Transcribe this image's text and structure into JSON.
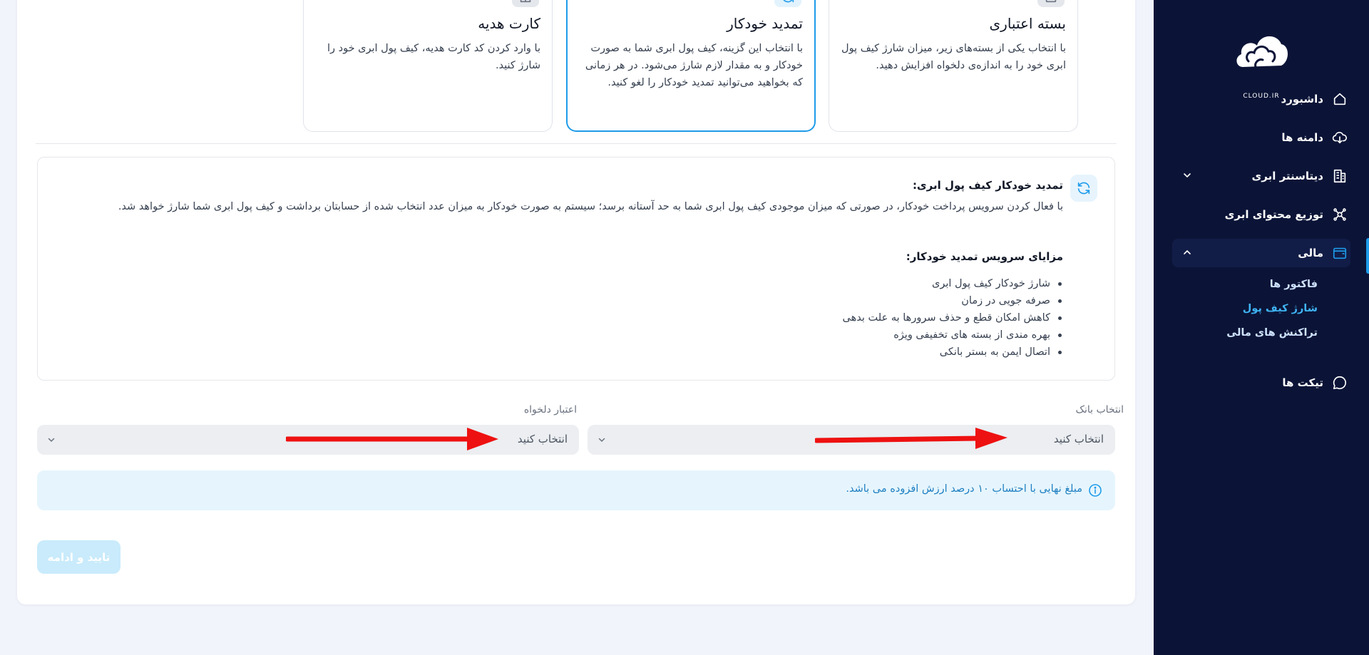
{
  "sidebar": {
    "logo_text": "CLOUD.IR",
    "items": [
      {
        "label": "داشبورد",
        "icon": "home-icon"
      },
      {
        "label": "دامنه ها",
        "icon": "cloud-download-icon"
      },
      {
        "label": "دیتاسنتر ابری",
        "icon": "building-icon"
      },
      {
        "label": "توزیع محتوای ابری",
        "icon": "network-icon"
      },
      {
        "label": "مالی",
        "icon": "wallet-icon"
      },
      {
        "label": "تیکت ها",
        "icon": "chat-bubble-icon"
      }
    ],
    "finance_subitems": [
      {
        "label": "فاکتور ها"
      },
      {
        "label": "شارژ کیف پول",
        "current": true
      },
      {
        "label": "تراکنش های مالی"
      }
    ]
  },
  "options": [
    {
      "title": "بسته اعتباری",
      "description": "با انتخاب یکی از بسته‌های زیر، میزان شارژ کیف پول ابری خود را به اندازه‌ی دلخواه افزایش دهید.",
      "icon": "archive-box-icon",
      "selected": false
    },
    {
      "title": "تمدید خودکار",
      "description": "با انتخاب این گزینه، کیف پول ابری شما به صورت خودکار و به مقدار لازم شارژ می‌شود. در هر زمانی که بخواهید می‌توانید تمدید خودکار را لغو کنید.",
      "icon": "refresh-icon",
      "selected": true
    },
    {
      "title": "کارت هدیه",
      "description": "با وارد کردن کد کارت هدیه، کیف پول ابری خود را شارژ کنید.",
      "icon": "gift-icon",
      "selected": false
    }
  ],
  "info": {
    "heading": "تمدید خودکار کیف پول ابری:",
    "body": "با فعال کردن سرویس پرداخت خودکار، در صورتی که میزان موجودی کیف پول ابری شما به حد آستانه برسد؛ سیستم به صورت خودکار به میزان عدد انتخاب شده از حسابتان برداشت و کیف پول ابری شما شارژ خواهد شد.",
    "benefits_title": "مزایای سرویس تمدید خودکار:",
    "benefits": [
      "شارژ خودکار کیف پول ابری",
      "صرفه جویی در زمان",
      "کاهش امکان قطع و حذف سرورها به علت بدهی",
      "بهره مندی از بسته های تخفیفی ویژه",
      "اتصال ایمن به بستر بانکی"
    ]
  },
  "form": {
    "bank_label": "انتخاب بانک",
    "bank_value": "انتخاب کنید",
    "credit_label": "اعتبار دلخواه",
    "credit_value": "انتخاب کنید"
  },
  "notice": "مبلغ نهایی با احتساب ۱۰ درصد ارزش افزوده می باشد.",
  "submit_label": "تایید و ادامه",
  "colors": {
    "sidebar_bg": "#0b1437",
    "accent": "#1e9be9",
    "annotation_arrow": "#ee1111"
  }
}
